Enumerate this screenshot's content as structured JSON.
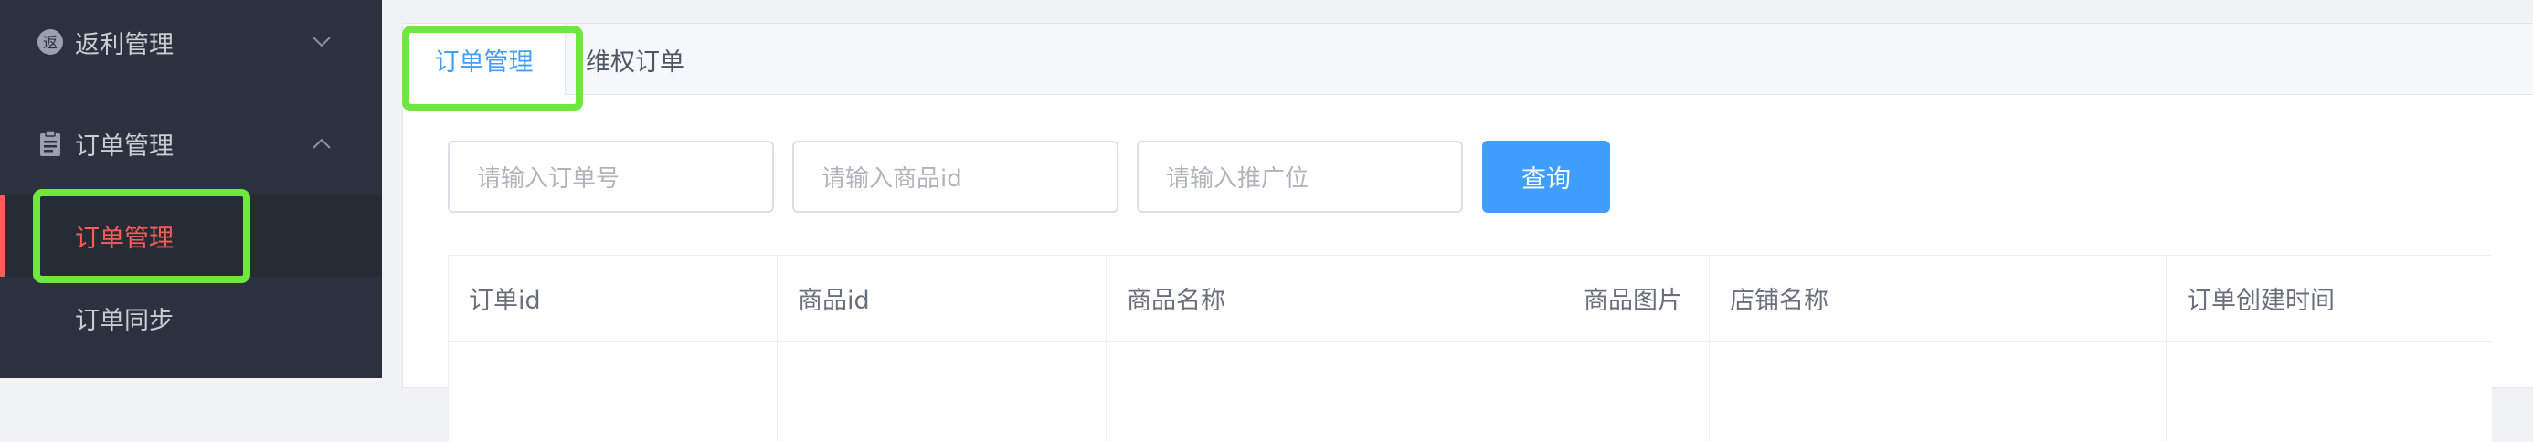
{
  "sidebar": {
    "groups": [
      {
        "label": "返利管理",
        "icon": "rebate-badge-icon",
        "expanded": false
      },
      {
        "label": "订单管理",
        "icon": "clipboard-icon",
        "expanded": true
      }
    ],
    "subitems": [
      {
        "label": "订单管理",
        "active": true
      },
      {
        "label": "订单同步",
        "active": false
      }
    ],
    "rebate_badge_char": "返"
  },
  "tabs": [
    {
      "label": "订单管理",
      "active": true
    },
    {
      "label": "维权订单",
      "active": false
    }
  ],
  "filters": {
    "order_no_placeholder": "请输入订单号",
    "product_id_placeholder": "请输入商品id",
    "promo_slot_placeholder": "请输入推广位",
    "query_label": "查询"
  },
  "table": {
    "columns": [
      "订单id",
      "商品id",
      "商品名称",
      "商品图片",
      "店铺名称",
      "订单创建时间"
    ]
  },
  "colors": {
    "sidebar_bg": "#2b323e",
    "accent_blue": "#409eff",
    "active_red": "#ff5b57",
    "highlight_green": "#6ee83c"
  }
}
